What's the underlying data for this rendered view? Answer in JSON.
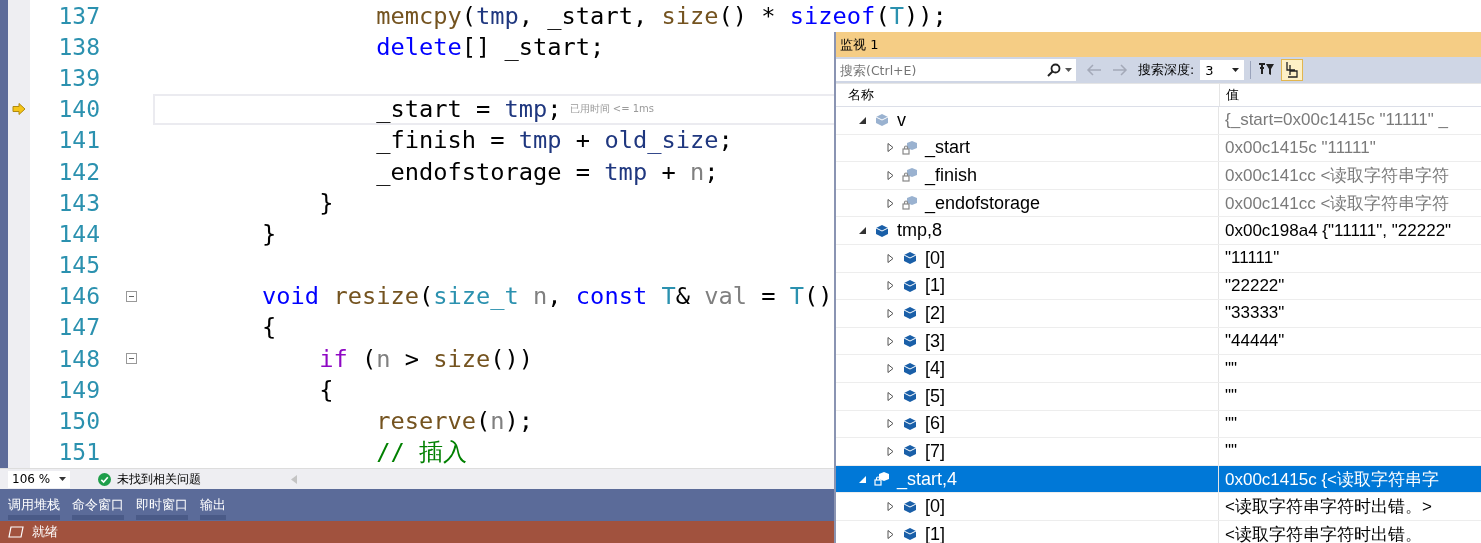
{
  "editor": {
    "lines": [
      {
        "number": "137",
        "fold": false,
        "current": false,
        "tokens": [
          {
            "text": "                memcpy",
            "kind": "func"
          },
          {
            "text": "(",
            "kind": "plain"
          },
          {
            "text": "tmp",
            "kind": "var"
          },
          {
            "text": ", _start, ",
            "kind": "plain"
          },
          {
            "text": "size",
            "kind": "func"
          },
          {
            "text": "() * ",
            "kind": "plain"
          },
          {
            "text": "sizeof",
            "kind": "keyword"
          },
          {
            "text": "(",
            "kind": "plain"
          },
          {
            "text": "T",
            "kind": "type"
          },
          {
            "text": "));",
            "kind": "plain"
          }
        ]
      },
      {
        "number": "138",
        "fold": false,
        "current": false,
        "tokens": [
          {
            "text": "                delete",
            "kind": "keyword"
          },
          {
            "text": "[] _start;",
            "kind": "plain"
          }
        ]
      },
      {
        "number": "139",
        "fold": false,
        "current": false
      },
      {
        "number": "140",
        "fold": false,
        "current": true,
        "hint": "已用时间 <= 1ms",
        "tokens": [
          {
            "text": "                _start = ",
            "kind": "plain"
          },
          {
            "text": "tmp",
            "kind": "var"
          },
          {
            "text": ";",
            "kind": "plain"
          }
        ]
      },
      {
        "number": "141",
        "fold": false,
        "current": false,
        "tokens": [
          {
            "text": "                _finish = ",
            "kind": "plain"
          },
          {
            "text": "tmp",
            "kind": "var"
          },
          {
            "text": " + ",
            "kind": "plain"
          },
          {
            "text": "old_size",
            "kind": "var"
          },
          {
            "text": ";",
            "kind": "plain"
          }
        ]
      },
      {
        "number": "142",
        "fold": false,
        "current": false,
        "tokens": [
          {
            "text": "                _endofstorage = ",
            "kind": "plain"
          },
          {
            "text": "tmp",
            "kind": "var"
          },
          {
            "text": " + ",
            "kind": "plain"
          },
          {
            "text": "n",
            "kind": "param"
          },
          {
            "text": ";",
            "kind": "plain"
          }
        ]
      },
      {
        "number": "143",
        "fold": false,
        "current": false,
        "tokens": [
          {
            "text": "            }",
            "kind": "plain"
          }
        ]
      },
      {
        "number": "144",
        "fold": false,
        "current": false,
        "tokens": [
          {
            "text": "        }",
            "kind": "plain"
          }
        ]
      },
      {
        "number": "145",
        "fold": false,
        "current": false
      },
      {
        "number": "146",
        "fold": true,
        "current": false,
        "tokens": [
          {
            "text": "        void",
            "kind": "keyword"
          },
          {
            "text": " resize",
            "kind": "func"
          },
          {
            "text": "(",
            "kind": "plain"
          },
          {
            "text": "size_t",
            "kind": "type"
          },
          {
            "text": " n",
            "kind": "param"
          },
          {
            "text": ", ",
            "kind": "plain"
          },
          {
            "text": "const",
            "kind": "keyword"
          },
          {
            "text": " T",
            "kind": "type"
          },
          {
            "text": "& ",
            "kind": "plain"
          },
          {
            "text": "val",
            "kind": "param"
          },
          {
            "text": " = ",
            "kind": "plain"
          },
          {
            "text": "T",
            "kind": "type"
          },
          {
            "text": "()",
            "kind": "plain"
          }
        ]
      },
      {
        "number": "147",
        "fold": false,
        "current": false,
        "tokens": [
          {
            "text": "        {",
            "kind": "plain"
          }
        ]
      },
      {
        "number": "148",
        "fold": true,
        "current": false,
        "tokens": [
          {
            "text": "            if",
            "kind": "control"
          },
          {
            "text": " (",
            "kind": "plain"
          },
          {
            "text": "n",
            "kind": "param"
          },
          {
            "text": " > ",
            "kind": "plain"
          },
          {
            "text": "size",
            "kind": "func"
          },
          {
            "text": "())",
            "kind": "plain"
          }
        ]
      },
      {
        "number": "149",
        "fold": false,
        "current": false,
        "tokens": [
          {
            "text": "            {",
            "kind": "plain"
          }
        ]
      },
      {
        "number": "150",
        "fold": false,
        "current": false,
        "tokens": [
          {
            "text": "                reserve",
            "kind": "func"
          },
          {
            "text": "(",
            "kind": "plain"
          },
          {
            "text": "n",
            "kind": "param"
          },
          {
            "text": ");",
            "kind": "plain"
          }
        ]
      },
      {
        "number": "151",
        "fold": false,
        "current": false,
        "tokens": [
          {
            "text": "                // 插入",
            "kind": "comment"
          }
        ]
      }
    ],
    "zoom": "106 %",
    "issues": "未找到相关问题"
  },
  "tool_tabs": [
    "调用堆栈",
    "命令窗口",
    "即时窗口",
    "输出"
  ],
  "status_bar": {
    "text": "就绪"
  },
  "watch": {
    "title": "监视 1",
    "search": {
      "placeholder": "搜索(Ctrl+E)"
    },
    "depth_label": "搜索深度:",
    "depth": "3",
    "hex_toggle": {
      "on": true
    },
    "columns": [
      "名称",
      "值"
    ],
    "items": [
      {
        "name": "v",
        "value": "{_start=0x00c1415c \"11111\" _",
        "kind": "variable",
        "stale": true,
        "expanded": true,
        "selected": false,
        "children": [
          {
            "name": "_start",
            "value": "0x00c1415c \"11111\"",
            "kind": "member",
            "stale": true,
            "expanded": false,
            "selected": false
          },
          {
            "name": "_finish",
            "value": "0x00c141cc <读取字符串字符",
            "kind": "member",
            "stale": true,
            "expanded": false,
            "selected": false
          },
          {
            "name": "_endofstorage",
            "value": "0x00c141cc <读取字符串字符",
            "kind": "member",
            "stale": true,
            "expanded": false,
            "selected": false
          }
        ]
      },
      {
        "name": "tmp,8",
        "value": "0x00c198a4 {\"11111\", \"22222\"",
        "kind": "variable",
        "stale": false,
        "expanded": true,
        "selected": false,
        "children": [
          {
            "name": "[0]",
            "value": "\"11111\"",
            "kind": "variable",
            "stale": false,
            "expanded": false,
            "selected": false
          },
          {
            "name": "[1]",
            "value": "\"22222\"",
            "kind": "variable",
            "stale": false,
            "expanded": false,
            "selected": false
          },
          {
            "name": "[2]",
            "value": "\"33333\"",
            "kind": "variable",
            "stale": false,
            "expanded": false,
            "selected": false
          },
          {
            "name": "[3]",
            "value": "\"44444\"",
            "kind": "variable",
            "stale": false,
            "expanded": false,
            "selected": false
          },
          {
            "name": "[4]",
            "value": "\"\"",
            "kind": "variable",
            "stale": false,
            "expanded": false,
            "selected": false
          },
          {
            "name": "[5]",
            "value": "\"\"",
            "kind": "variable",
            "stale": false,
            "expanded": false,
            "selected": false
          },
          {
            "name": "[6]",
            "value": "\"\"",
            "kind": "variable",
            "stale": false,
            "expanded": false,
            "selected": false
          },
          {
            "name": "[7]",
            "value": "\"\"",
            "kind": "variable",
            "stale": false,
            "expanded": false,
            "selected": false
          }
        ]
      },
      {
        "name": "_start,4",
        "value": "0x00c1415c {<读取字符串字",
        "kind": "member",
        "stale": false,
        "expanded": true,
        "selected": true,
        "children": [
          {
            "name": "[0]",
            "value": "<读取字符串字符时出错。>",
            "kind": "variable",
            "stale": false,
            "expanded": false,
            "selected": false
          },
          {
            "name": "[1]",
            "value": "<读取字符串字符时出错。",
            "kind": "variable",
            "stale": false,
            "expanded": false,
            "selected": false
          }
        ]
      }
    ]
  }
}
